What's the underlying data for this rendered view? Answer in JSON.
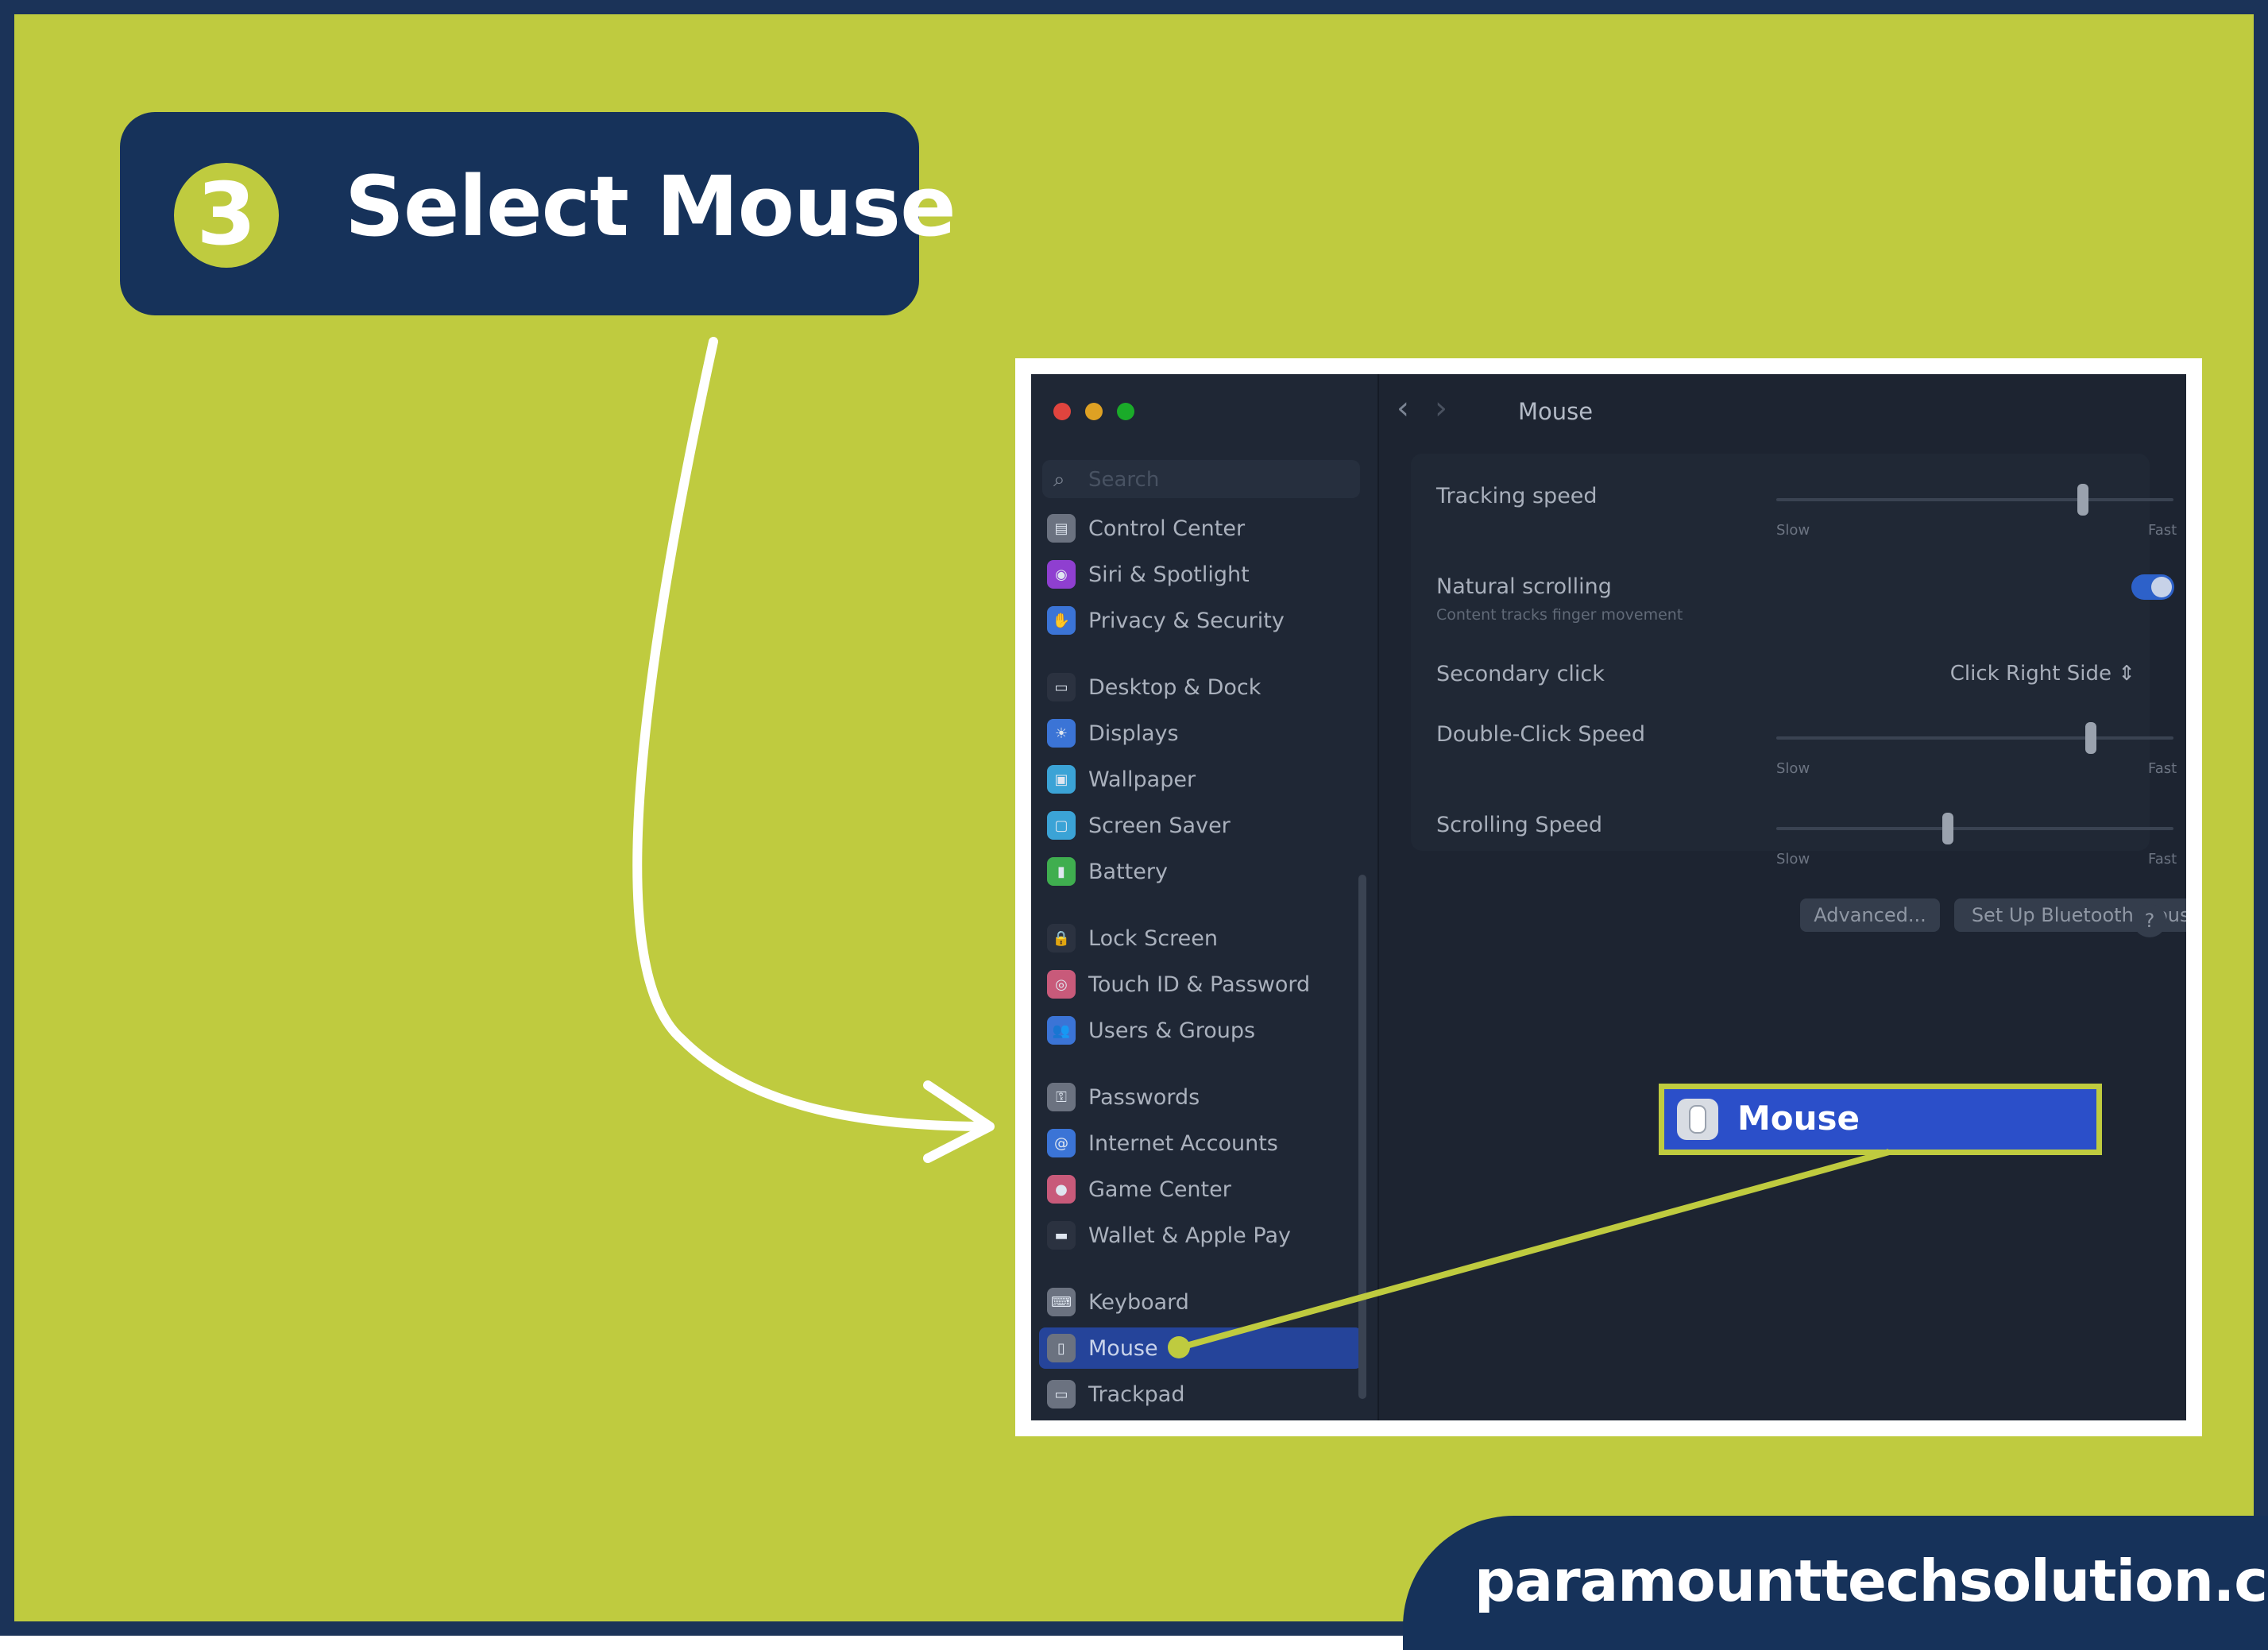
{
  "step": {
    "number": "3",
    "title": "Select Mouse"
  },
  "window": {
    "traffic_lights": [
      "#e0443e",
      "#dea123",
      "#1aab29"
    ],
    "sidebar": {
      "search_placeholder": "Search",
      "items": [
        {
          "label": "Control Center",
          "icon": "control-center-icon",
          "color": "#6b7280",
          "active": false
        },
        {
          "label": "Siri & Spotlight",
          "icon": "siri-icon",
          "color": "#8f3fd0",
          "active": false
        },
        {
          "label": "Privacy & Security",
          "icon": "hand-icon",
          "color": "#3b74d6",
          "active": false
        },
        {
          "label": "Desktop & Dock",
          "icon": "dock-icon",
          "color": "#2b3240",
          "active": false
        },
        {
          "label": "Displays",
          "icon": "sun-icon",
          "color": "#3b74d6",
          "active": false
        },
        {
          "label": "Wallpaper",
          "icon": "wallpaper-icon",
          "color": "#3ba3d6",
          "active": false
        },
        {
          "label": "Screen Saver",
          "icon": "screen-saver-icon",
          "color": "#3ba3d6",
          "active": false
        },
        {
          "label": "Battery",
          "icon": "battery-icon",
          "color": "#3fae4f",
          "active": false
        },
        {
          "label": "Lock Screen",
          "icon": "lock-icon",
          "color": "#2b3240",
          "active": false
        },
        {
          "label": "Touch ID & Password",
          "icon": "fingerprint-icon",
          "color": "#c85a7a",
          "active": false
        },
        {
          "label": "Users & Groups",
          "icon": "users-icon",
          "color": "#3b74d6",
          "active": false
        },
        {
          "label": "Passwords",
          "icon": "key-icon",
          "color": "#6b7280",
          "active": false
        },
        {
          "label": "Internet Accounts",
          "icon": "at-icon",
          "color": "#3b74d6",
          "active": false
        },
        {
          "label": "Game Center",
          "icon": "game-center-icon",
          "color": "#c85a7a",
          "active": false
        },
        {
          "label": "Wallet & Apple Pay",
          "icon": "wallet-icon",
          "color": "#2b3240",
          "active": false
        },
        {
          "label": "Keyboard",
          "icon": "keyboard-icon",
          "color": "#6b7280",
          "active": false
        },
        {
          "label": "Mouse",
          "icon": "mouse-icon",
          "color": "#6b7280",
          "active": true
        },
        {
          "label": "Trackpad",
          "icon": "trackpad-icon",
          "color": "#6b7280",
          "active": false
        }
      ]
    },
    "main": {
      "title": "Mouse",
      "back_glyph": "‹",
      "forward_glyph": "›",
      "tracking_speed": {
        "label": "Tracking speed",
        "slow": "Slow",
        "fast": "Fast",
        "value": 0.78
      },
      "natural_scrolling": {
        "label": "Natural scrolling",
        "sublabel": "Content tracks finger movement",
        "on": true
      },
      "secondary_click": {
        "label": "Secondary click",
        "value": "Click Right Side ⇕"
      },
      "double_click_speed": {
        "label": "Double-Click Speed",
        "slow": "Slow",
        "fast": "Fast",
        "value": 0.8
      },
      "scrolling_speed": {
        "label": "Scrolling Speed",
        "slow": "Slow",
        "fast": "Fast",
        "value": 0.43
      },
      "buttons": {
        "advanced": "Advanced...",
        "bluetooth": "Set Up Bluetooth Mouse...",
        "help": "?"
      }
    }
  },
  "callout": {
    "label": "Mouse"
  },
  "footer": {
    "site": "paramounttechsolution.com"
  },
  "colors": {
    "accent": "#bfcb3f",
    "navy": "#16325a",
    "selection": "#2b4fc9"
  }
}
